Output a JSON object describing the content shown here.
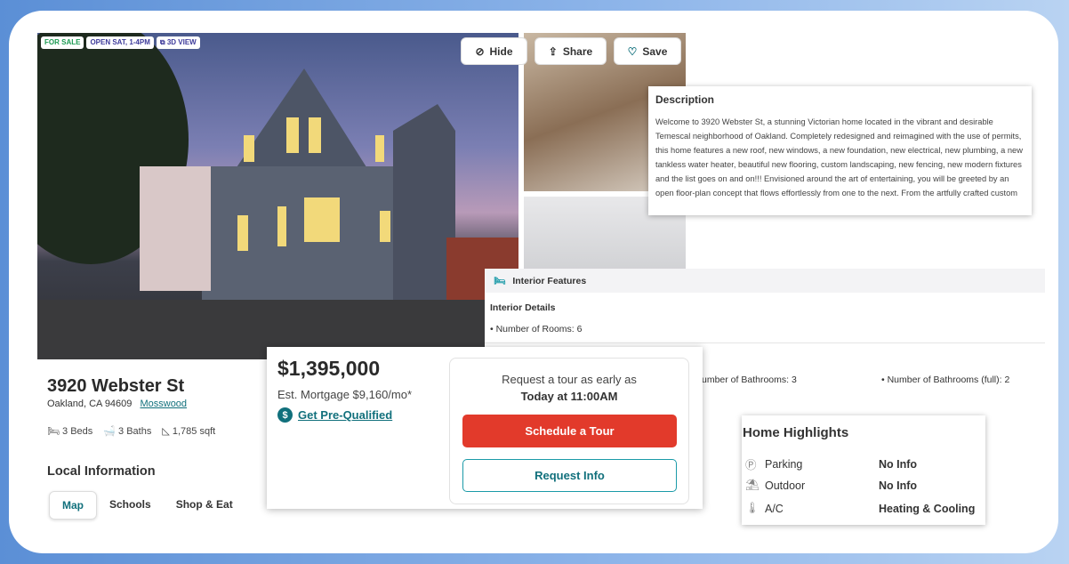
{
  "badges": {
    "for_sale": "FOR SALE",
    "open_house": "OPEN SAT, 1-4PM",
    "view_3d": "3D VIEW"
  },
  "toolbar": {
    "hide": "Hide",
    "share": "Share",
    "save": "Save"
  },
  "description": {
    "title": "Description",
    "text": "Welcome to 3920 Webster St, a stunning Victorian home located in the vibrant and desirable Temescal neighborhood of Oakland. Completely redesigned and reimagined with the use of permits, this home features a new roof, new windows, a new foundation, new electrical, new plumbing, a new tankless water heater, beautiful new flooring, custom landscaping, new fencing, new modern fixtures and the list goes on and on!!! Envisioned around the art of entertaining, you will be greeted by an open floor-plan concept that flows effortlessly from one to the next. From the artfully crafted custom"
  },
  "interior": {
    "title": "Interior Features",
    "subtitle": "Interior Details",
    "rooms": "• Number of Rooms: 6",
    "bathrooms": "umber of Bathrooms: 3",
    "bathrooms_full": "• Number of Bathrooms (full): 2"
  },
  "listing": {
    "address": "3920 Webster St",
    "city": "Oakland, CA 94609",
    "neighborhood": "Mosswood",
    "beds": "3 Beds",
    "baths": "3 Baths",
    "sqft": "1,785 sqft"
  },
  "local": {
    "title": "Local Information",
    "tabs": [
      "Map",
      "Schools",
      "Shop & Eat"
    ]
  },
  "price": {
    "amount": "$1,395,000",
    "mortgage": "Est. Mortgage $9,160/mo*",
    "prequal": "Get Pre-Qualified"
  },
  "tour": {
    "line1": "Request a tour as early as",
    "line2": "Today at 11:00AM",
    "schedule": "Schedule a Tour",
    "request": "Request Info"
  },
  "highlights": {
    "title": "Home Highlights",
    "rows": [
      {
        "label": "Parking",
        "value": "No Info"
      },
      {
        "label": "Outdoor",
        "value": "No Info"
      },
      {
        "label": "A/C",
        "value": "Heating & Cooling"
      }
    ]
  },
  "colors": {
    "accent": "#e23a2b",
    "teal": "#1a9aa8"
  }
}
